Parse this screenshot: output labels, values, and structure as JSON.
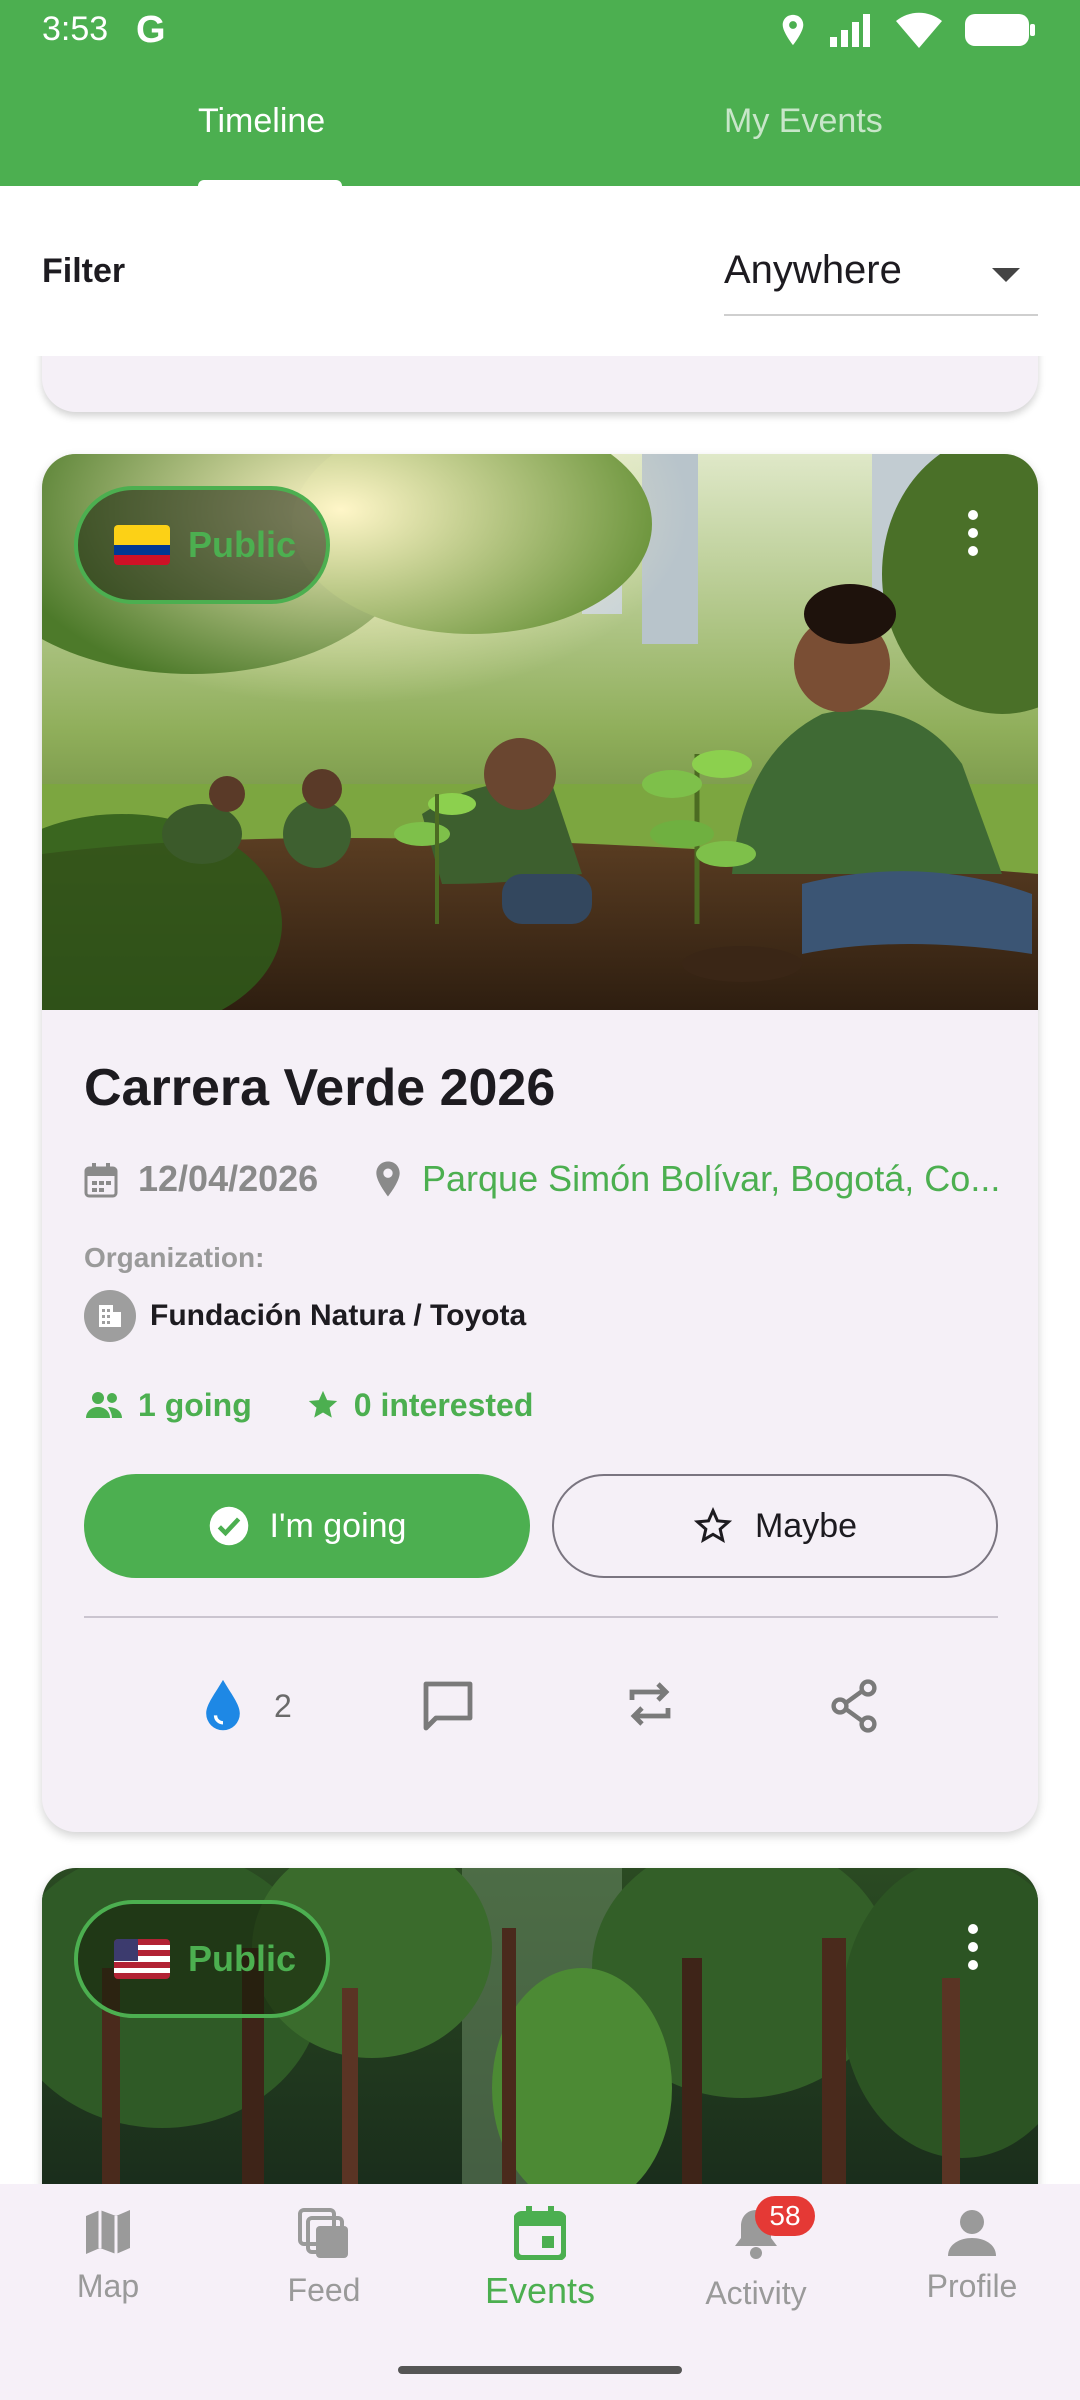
{
  "status_bar": {
    "time": "3:53",
    "g_label": "G"
  },
  "tabs": {
    "timeline": "Timeline",
    "my_events": "My Events"
  },
  "filter": {
    "label": "Filter",
    "selected": "Anywhere"
  },
  "cards": [
    {
      "visibility": "Public",
      "flag": "Colombia",
      "title": "Carrera Verde 2026",
      "date": "12/04/2026",
      "location": "Parque Simón Bolívar, Bogotá, Co...",
      "organization_label": "Organization:",
      "organization": "Fundación Natura / Toyota",
      "going": "1 going",
      "interested": "0 interested",
      "btn_going": "I'm going",
      "btn_maybe": "Maybe",
      "drops": "2"
    },
    {
      "visibility": "Public",
      "flag": "United States"
    }
  ],
  "bottom_nav": {
    "map": "Map",
    "feed": "Feed",
    "events": "Events",
    "activity": "Activity",
    "profile": "Profile",
    "activity_badge": "58"
  },
  "colors": {
    "primary": "#4caf50",
    "badge": "#e53935",
    "drop": "#1e88e5"
  }
}
